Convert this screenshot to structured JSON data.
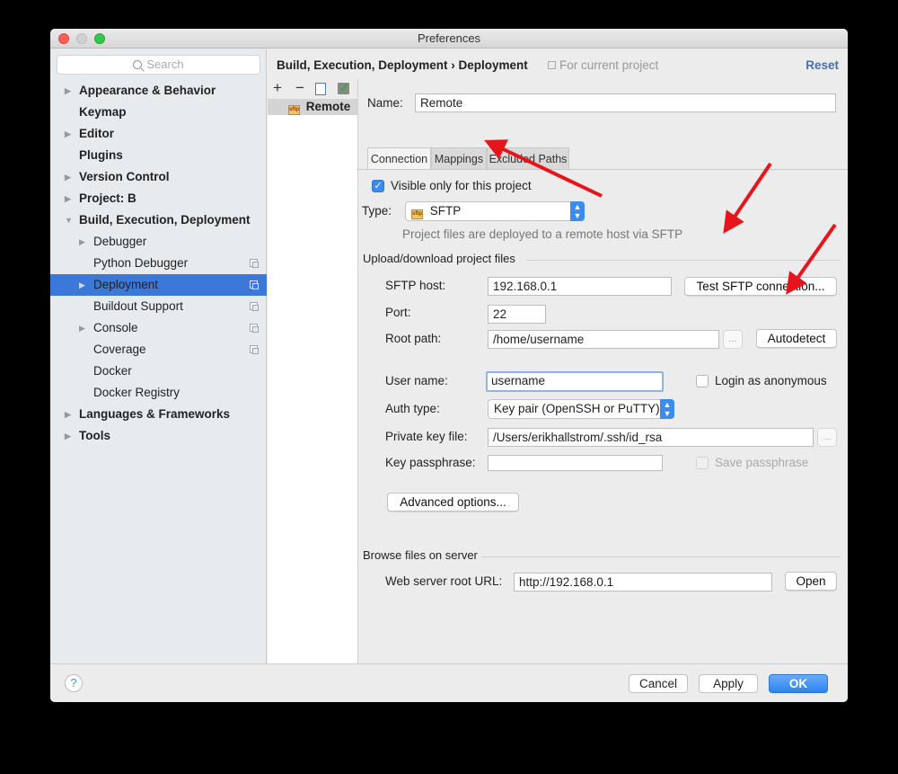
{
  "window": {
    "title": "Preferences"
  },
  "sidebar": {
    "search_placeholder": "Search",
    "items": [
      {
        "label": "Appearance & Behavior",
        "bold": true,
        "expandable": true
      },
      {
        "label": "Keymap",
        "bold": true,
        "expandable": false
      },
      {
        "label": "Editor",
        "bold": true,
        "expandable": true
      },
      {
        "label": "Plugins",
        "bold": true,
        "expandable": false
      },
      {
        "label": "Version Control",
        "bold": true,
        "expandable": true
      },
      {
        "label": "Project: B",
        "bold": true,
        "expandable": true
      },
      {
        "label": "Build, Execution, Deployment",
        "bold": true,
        "expanded": true
      },
      {
        "label": "Debugger",
        "child": true,
        "expandable": true
      },
      {
        "label": "Python Debugger",
        "child": true,
        "project_icon": true
      },
      {
        "label": "Deployment",
        "child": true,
        "expandable": true,
        "project_icon": true,
        "selected": true
      },
      {
        "label": "Buildout Support",
        "child": true,
        "project_icon": true
      },
      {
        "label": "Console",
        "child": true,
        "expandable": true,
        "project_icon": true
      },
      {
        "label": "Coverage",
        "child": true,
        "project_icon": true
      },
      {
        "label": "Docker",
        "child": true
      },
      {
        "label": "Docker Registry",
        "child": true
      },
      {
        "label": "Languages & Frameworks",
        "bold": true,
        "expandable": true
      },
      {
        "label": "Tools",
        "bold": true,
        "expandable": true
      }
    ]
  },
  "header": {
    "breadcrumb": "Build, Execution, Deployment › Deployment",
    "scope_note": "For current project",
    "reset_label": "Reset"
  },
  "servers": {
    "toolbar": {
      "add": "+",
      "remove": "−"
    },
    "items": [
      {
        "label": "Remote",
        "icon": "sftp-icon"
      }
    ]
  },
  "form": {
    "name_label": "Name:",
    "name_value": "Remote",
    "tabs": [
      {
        "label": "Connection",
        "active": true
      },
      {
        "label": "Mappings",
        "active": false
      },
      {
        "label": "Excluded Paths",
        "active": false
      }
    ],
    "visible_only_label": "Visible only for this project",
    "visible_only_checked": true,
    "type_label": "Type:",
    "type_value": "SFTP",
    "type_hint": "Project files are deployed to a remote host via SFTP",
    "upload_section": "Upload/download project files",
    "sftp_host_label": "SFTP host:",
    "sftp_host_value": "192.168.0.1",
    "test_button": "Test SFTP connection...",
    "port_label": "Port:",
    "port_value": "22",
    "root_path_label": "Root path:",
    "root_path_value": "/home/username",
    "browse_dots": "...",
    "autodetect_button": "Autodetect",
    "user_name_label": "User name:",
    "user_name_value": "username",
    "login_anon_label": "Login as anonymous",
    "login_anon_checked": false,
    "auth_type_label": "Auth type:",
    "auth_type_value": "Key pair (OpenSSH or PuTTY)",
    "private_key_label": "Private key file:",
    "private_key_value": "/Users/erikhallstrom/.ssh/id_rsa",
    "passphrase_label": "Key passphrase:",
    "passphrase_value": "",
    "save_passphrase_label": "Save passphrase",
    "save_passphrase_checked": false,
    "advanced_button": "Advanced options...",
    "browse_section": "Browse files on server",
    "web_root_label": "Web server root URL:",
    "web_root_value": "http://192.168.0.1",
    "open_button": "Open"
  },
  "footer": {
    "help": "?",
    "cancel": "Cancel",
    "apply": "Apply",
    "ok": "OK"
  },
  "annotations": {
    "arrow_color": "#e8141c",
    "arrows": [
      "points-to-mappings-tab",
      "points-to-test-sftp-connection",
      "points-to-autodetect"
    ]
  }
}
